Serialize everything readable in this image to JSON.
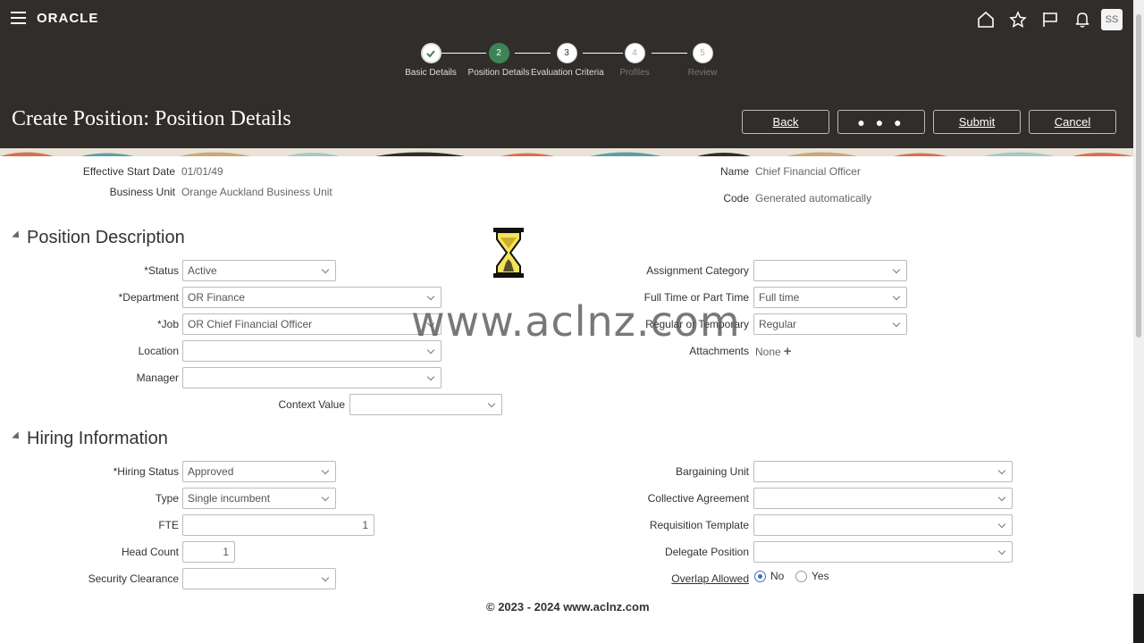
{
  "header": {
    "logo": "ORACLE",
    "avatar": "SS",
    "icons": [
      "menu-icon",
      "home-icon",
      "favorite-icon",
      "flag-icon",
      "notifications-icon"
    ]
  },
  "train": {
    "stops": [
      {
        "num": "",
        "label": "Basic Details",
        "state": "done"
      },
      {
        "num": "2",
        "label": "Position Details",
        "state": "current"
      },
      {
        "num": "3",
        "label": "Evaluation Criteria",
        "state": "next"
      },
      {
        "num": "4",
        "label": "Profiles",
        "state": "future"
      },
      {
        "num": "5",
        "label": "Review",
        "state": "future"
      }
    ]
  },
  "page": {
    "title": "Create Position: Position Details",
    "buttons": {
      "back": "Back",
      "more": "● ● ●",
      "submit": "Submit",
      "cancel": "Cancel"
    }
  },
  "summary": {
    "effective_start_label": "Effective Start Date",
    "effective_start_value": "01/01/49",
    "business_unit_label": "Business Unit",
    "business_unit_value": "Orange Auckland Business Unit",
    "name_label": "Name",
    "name_value": "Chief Financial Officer",
    "code_label": "Code",
    "code_value": "Generated automatically"
  },
  "position_description": {
    "title": "Position Description",
    "status_label": "Status",
    "status_value": "Active",
    "department_label": "Department",
    "department_value": "OR Finance",
    "job_label": "Job",
    "job_value": "OR Chief Financial Officer",
    "location_label": "Location",
    "location_value": "",
    "manager_label": "Manager",
    "manager_value": "",
    "context_label": "Context Value",
    "context_value": "",
    "assignment_category_label": "Assignment Category",
    "assignment_category_value": "",
    "full_part_label": "Full Time or Part Time",
    "full_part_value": "Full time",
    "regular_temp_label": "Regular or Temporary",
    "regular_temp_value": "Regular",
    "attachments_label": "Attachments",
    "attachments_value": "None"
  },
  "hiring_information": {
    "title": "Hiring Information",
    "hiring_status_label": "Hiring Status",
    "hiring_status_value": "Approved",
    "type_label": "Type",
    "type_value": "Single incumbent",
    "fte_label": "FTE",
    "fte_value": "1",
    "head_count_label": "Head Count",
    "head_count_value": "1",
    "security_label": "Security Clearance",
    "security_value": "",
    "bargaining_label": "Bargaining Unit",
    "bargaining_value": "",
    "collective_label": "Collective Agreement",
    "collective_value": "",
    "requisition_label": "Requisition Template",
    "requisition_value": "",
    "delegate_label": "Delegate Position",
    "delegate_value": "",
    "overlap_label": "Overlap Allowed",
    "overlap_no": "No",
    "overlap_yes": "Yes",
    "overlap_selected": "No"
  },
  "watermark": "www.aclnz.com",
  "footer": "© 2023 - 2024 www.aclnz.com",
  "colors": {
    "header_bg": "#312d2a",
    "train_current": "#3e8357",
    "radio_selected": "#3a72c0"
  }
}
